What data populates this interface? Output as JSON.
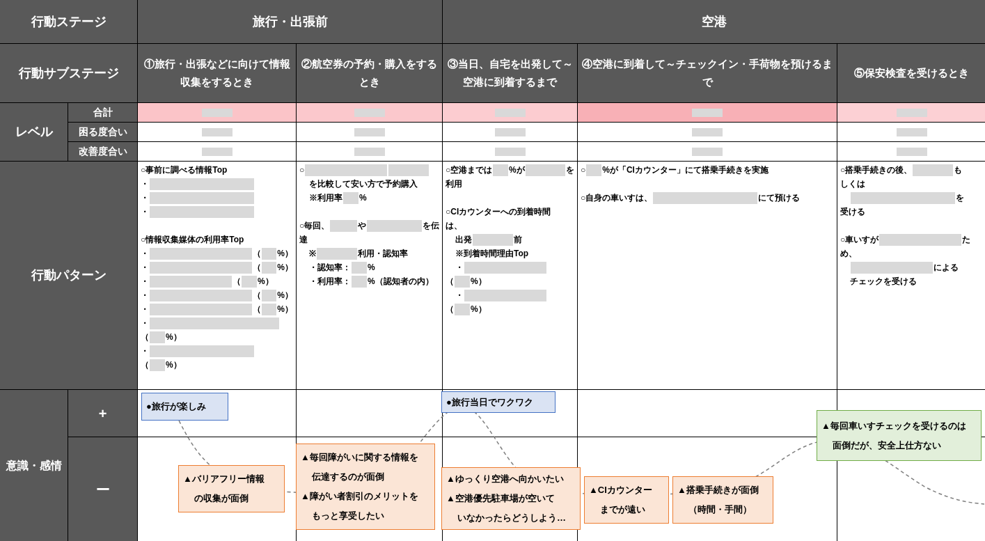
{
  "header": {
    "stage_label": "行動ステージ",
    "substage_label": "行動サブステージ",
    "level_label": "レベル",
    "level_rows": [
      "合計",
      "困る度合い",
      "改善度合い"
    ],
    "pattern_label": "行動パターン",
    "emotion_label": "意識・感情",
    "plus_label": "+",
    "minus_label": "ー"
  },
  "stages": [
    {
      "label": "旅行・出張前",
      "substages": [
        {
          "label": "①旅行・出張などに向けて情報収集をするとき",
          "level_cells": [
            {
              "color": "#fbc4c8"
            },
            {
              "color": "#ffffff"
            },
            {
              "color": "#ffffff"
            }
          ],
          "pattern": [
            {
              "kind": "line",
              "indent": false,
              "segments": [
                "○事前に調べる情報Top"
              ]
            },
            {
              "kind": "line",
              "indent": false,
              "segments": [
                "・",
                {
                  "kind": "redacted_long"
                }
              ]
            },
            {
              "kind": "line",
              "indent": false,
              "segments": [
                "・",
                {
                  "kind": "redacted_long"
                }
              ]
            },
            {
              "kind": "line",
              "indent": false,
              "segments": [
                "・",
                {
                  "kind": "redacted_long"
                }
              ]
            },
            {
              "kind": "gap"
            },
            {
              "kind": "line",
              "indent": false,
              "segments": [
                "○情報収集媒体の利用率Top"
              ]
            },
            {
              "kind": "line",
              "indent": false,
              "segments": [
                "・",
                {
                  "kind": "redacted_long"
                },
                "（",
                {
                  "kind": "redacted_tiny"
                },
                "%）"
              ]
            },
            {
              "kind": "line",
              "indent": false,
              "segments": [
                "・",
                {
                  "kind": "redacted_long"
                },
                "（",
                {
                  "kind": "redacted_tiny"
                },
                "%）"
              ]
            },
            {
              "kind": "line",
              "indent": false,
              "segments": [
                "・",
                {
                  "kind": "redacted_medium"
                },
                "（",
                {
                  "kind": "redacted_tiny"
                },
                "%）"
              ]
            },
            {
              "kind": "line",
              "indent": false,
              "segments": [
                "・",
                {
                  "kind": "redacted_long"
                },
                "（",
                {
                  "kind": "redacted_tiny"
                },
                "%）"
              ]
            },
            {
              "kind": "line",
              "indent": false,
              "segments": [
                "・",
                {
                  "kind": "redacted_long"
                },
                "（",
                {
                  "kind": "redacted_tiny"
                },
                "%）"
              ]
            },
            {
              "kind": "line",
              "indent": false,
              "segments": [
                "・",
                {
                  "kind": "redacted_full"
                }
              ]
            },
            {
              "kind": "line",
              "indent": false,
              "segments": [
                "（",
                {
                  "kind": "redacted_tiny"
                },
                "%）"
              ]
            },
            {
              "kind": "line",
              "indent": false,
              "segments": [
                "・",
                {
                  "kind": "redacted_long"
                }
              ]
            },
            {
              "kind": "line",
              "indent": false,
              "segments": [
                "（",
                {
                  "kind": "redacted_tiny"
                },
                "%）"
              ]
            }
          ]
        },
        {
          "label": "②航空券の予約・購入をするとき",
          "level_cells": [
            {
              "color": "#fbc8cc"
            },
            {
              "color": "#ffffff"
            },
            {
              "color": "#ffffff"
            }
          ],
          "pattern": [
            {
              "kind": "line",
              "indent": false,
              "segments": [
                "○ ",
                {
                  "kind": "redacted_medium"
                },
                {
                  "kind": "redacted_short"
                }
              ]
            },
            {
              "kind": "line",
              "indent": true,
              "segments": [
                "を比較して安い方で予約購入"
              ]
            },
            {
              "kind": "line",
              "indent": true,
              "segments": [
                "※利用率 ",
                {
                  "kind": "redacted_tiny"
                },
                "%"
              ]
            },
            {
              "kind": "gap"
            },
            {
              "kind": "line",
              "indent": false,
              "segments": [
                "○毎回、",
                {
                  "kind": "redacted_short"
                },
                "や",
                {
                  "kind": "redacted_medium"
                },
                "を伝"
              ]
            },
            {
              "kind": "line",
              "indent": false,
              "segments": [
                "達"
              ]
            },
            {
              "kind": "line",
              "indent": true,
              "segments": [
                "※ ",
                {
                  "kind": "redacted_short"
                },
                "利用・認知率"
              ]
            },
            {
              "kind": "line",
              "indent": true,
              "segments": [
                "・認知率：",
                {
                  "kind": "redacted_tiny"
                },
                "%"
              ]
            },
            {
              "kind": "line",
              "indent": true,
              "segments": [
                "・利用率：",
                {
                  "kind": "redacted_tiny"
                },
                "%（認知者の内）"
              ]
            }
          ]
        }
      ]
    },
    {
      "label": "空港",
      "substages": [
        {
          "label": "③当日、自宅を出発して～空港に到着するまで",
          "level_cells": [
            {
              "color": "#fcccd0"
            },
            {
              "color": "#ffffff"
            },
            {
              "color": "#ffffff"
            }
          ],
          "pattern": [
            {
              "kind": "line",
              "indent": false,
              "segments": [
                "○空港までは",
                {
                  "kind": "redacted_tiny"
                },
                "%が ",
                {
                  "kind": "redacted_short"
                },
                " を"
              ]
            },
            {
              "kind": "line",
              "indent": false,
              "segments": [
                "利用"
              ]
            },
            {
              "kind": "gap"
            },
            {
              "kind": "line",
              "indent": false,
              "segments": [
                "○CIカウンターへの到着時間"
              ]
            },
            {
              "kind": "line",
              "indent": false,
              "segments": [
                "は、"
              ]
            },
            {
              "kind": "line",
              "indent": true,
              "segments": [
                "出発",
                {
                  "kind": "redacted_short"
                },
                "前"
              ]
            },
            {
              "kind": "line",
              "indent": true,
              "segments": [
                "※到着時間理由Top"
              ]
            },
            {
              "kind": "line",
              "indent": true,
              "segments": [
                "・",
                {
                  "kind": "redacted_medium"
                }
              ]
            },
            {
              "kind": "line",
              "indent": false,
              "segments": [
                "（",
                {
                  "kind": "redacted_tiny"
                },
                "%）"
              ]
            },
            {
              "kind": "line",
              "indent": true,
              "segments": [
                "・",
                {
                  "kind": "redacted_medium"
                }
              ]
            },
            {
              "kind": "line",
              "indent": false,
              "segments": [
                "（",
                {
                  "kind": "redacted_tiny"
                },
                "%）"
              ]
            }
          ]
        },
        {
          "label": "④空港に到着して～チェックイン・手荷物を預けるまで",
          "level_cells": [
            {
              "color": "#f8b0b6"
            },
            {
              "color": "#ffffff"
            },
            {
              "color": "#ffffff"
            }
          ],
          "pattern": [
            {
              "kind": "line",
              "indent": false,
              "segments": [
                "○",
                {
                  "kind": "redacted_tiny"
                },
                "%が「CIカウンター」にて搭乗手続きを実施"
              ]
            },
            {
              "kind": "gap"
            },
            {
              "kind": "line",
              "indent": false,
              "segments": [
                "○自身の車いすは、",
                {
                  "kind": "redacted_long"
                },
                " にて預ける"
              ]
            }
          ]
        },
        {
          "label": "⑤保安検査を受けるとき",
          "level_cells": [
            {
              "color": "#fcd0d4"
            },
            {
              "color": "#ffffff"
            },
            {
              "color": "#ffffff"
            }
          ],
          "pattern": [
            {
              "kind": "line",
              "indent": false,
              "segments": [
                "○搭乗手続きの後、",
                {
                  "kind": "redacted_short"
                },
                "も"
              ]
            },
            {
              "kind": "line",
              "indent": false,
              "segments": [
                "しくは"
              ]
            },
            {
              "kind": "line",
              "indent": true,
              "segments": [
                {
                  "kind": "redacted_long"
                },
                "を"
              ]
            },
            {
              "kind": "line",
              "indent": false,
              "segments": [
                "受ける"
              ]
            },
            {
              "kind": "gap"
            },
            {
              "kind": "line",
              "indent": false,
              "segments": [
                "○車いすが",
                {
                  "kind": "redacted_medium"
                },
                "た"
              ]
            },
            {
              "kind": "line",
              "indent": false,
              "segments": [
                "め、"
              ]
            },
            {
              "kind": "line",
              "indent": true,
              "segments": [
                {
                  "kind": "redacted_medium"
                },
                " による"
              ]
            },
            {
              "kind": "line",
              "indent": true,
              "segments": [
                "チェックを受ける"
              ]
            }
          ]
        }
      ]
    }
  ],
  "emotion_notes": [
    {
      "kind": "positive",
      "lines": [
        {
          "text": "●旅行が楽しみ",
          "indent": false
        }
      ]
    },
    {
      "kind": "negative",
      "lines": [
        {
          "text": "▲バリアフリー情報",
          "indent": false
        },
        {
          "text": "の収集が面倒",
          "indent": true
        }
      ]
    },
    {
      "kind": "negative",
      "lines": [
        {
          "text": "▲毎回障がいに関する情報を",
          "indent": false
        },
        {
          "text": "伝達するのが面倒",
          "indent": true
        },
        {
          "text": "▲障がい者割引のメリットを",
          "indent": false
        },
        {
          "text": "もっと享受したい",
          "indent": true
        }
      ]
    },
    {
      "kind": "positive",
      "lines": [
        {
          "text": "●旅行当日でワクワク",
          "indent": false
        }
      ]
    },
    {
      "kind": "negative",
      "lines": [
        {
          "text": "▲ゆっくり空港へ向かいたい",
          "indent": false
        },
        {
          "text": "▲空港優先駐車場が空いて",
          "indent": false
        },
        {
          "text": "いなかったらどうしよう…",
          "indent": true
        }
      ]
    },
    {
      "kind": "negative",
      "lines": [
        {
          "text": "▲CIカウンター",
          "indent": false
        },
        {
          "text": "までが遠い",
          "indent": true
        }
      ]
    },
    {
      "kind": "negative",
      "lines": [
        {
          "text": "▲搭乗手続きが面倒",
          "indent": false
        },
        {
          "text": "（時間・手間）",
          "indent": true
        }
      ]
    },
    {
      "kind": "neutral",
      "lines": [
        {
          "text": "▲毎回車いすチェックを受けるのは",
          "indent": false
        },
        {
          "text": "面倒だが、安全上仕方ない",
          "indent": true
        }
      ]
    }
  ]
}
